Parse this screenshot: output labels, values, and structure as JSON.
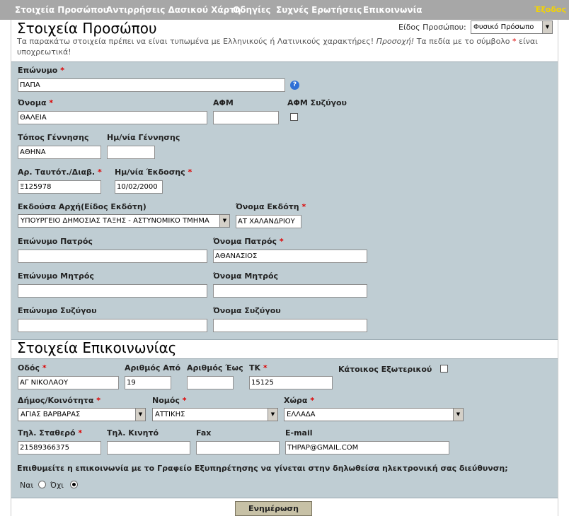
{
  "nav": {
    "items": [
      "Στοιχεία Προσώπου",
      "Αντιρρήσεις Δασικού Χάρτη",
      "Οδηγίες",
      "Συχνές Ερωτήσεις",
      "Επικοινωνία"
    ],
    "exit": "Έξοδος"
  },
  "person": {
    "title": "Στοιχεία Προσώπου",
    "type_label": "Είδος Προσώπου:",
    "type_value": "Φυσικό Πρόσωπο",
    "note_start": "Τα παρακάτω στοιχεία πρέπει να είναι τυπωμένα με Ελληνικούς ή Λατινικούς χαρακτήρες!",
    "note_em": "Προσοχή!",
    "note_mid": "Τα πεδία με το σύμβολο",
    "note_star": "*",
    "note_end": "είναι υποχρεωτικά!",
    "labels": {
      "surname": "Επώνυμο",
      "name": "Όνομα",
      "afm": "ΑΦΜ",
      "afm_spouse": "ΑΦΜ Συζύγου",
      "birthplace": "Τόπος Γέννησης",
      "birthdate": "Ημ/νία Γέννησης",
      "id_number": "Αρ. Ταυτότ./Διαβ.",
      "issue_date": "Ημ/νία Έκδοσης",
      "issuer_type": "Εκδούσα Αρχή(Είδος Εκδότη)",
      "issuer_name": "Όνομα Εκδότη",
      "father_surname": "Επώνυμο Πατρός",
      "father_name": "Όνομα Πατρός",
      "mother_surname": "Επώνυμο Μητρός",
      "mother_name": "Όνομα Μητρός",
      "spouse_surname": "Επώνυμο Συζύγου",
      "spouse_name": "Όνομα Συζύγου"
    },
    "values": {
      "surname": "ΠΑΠΑ",
      "name": "ΘΑΛΕΙΑ",
      "afm": "",
      "birthplace": "ΑΘΗΝΑ",
      "birthdate": "",
      "id_number": "Ξ125978",
      "issue_date": "10/02/2000",
      "issuer_type": "ΥΠΟΥΡΓΕΙΟ ΔΗΜΟΣΙΑΣ ΤΑΞΗΣ - ΑΣΤΥΝΟΜΙΚΟ ΤΜΗΜΑ",
      "issuer_name": "ΑΤ ΧΑΛΑΝΔΡΙΟΥ",
      "father_surname": "",
      "father_name": "ΑΘΑΝΑΣΙΟΣ",
      "mother_surname": "",
      "mother_name": "",
      "spouse_surname": "",
      "spouse_name": ""
    },
    "required_mark": "*",
    "help_glyph": "?"
  },
  "contact": {
    "title": "Στοιχεία Επικοινωνίας",
    "labels": {
      "street": "Οδός",
      "number_from": "Αριθμός Από",
      "number_to": "Αριθμός Έως",
      "zip": "ΤΚ",
      "abroad": "Κάτοικος Εξωτερικού",
      "municipality": "Δήμος/Κοινότητα",
      "prefecture": "Νομός",
      "country": "Χώρα",
      "phone": "Τηλ. Σταθερό",
      "mobile": "Τηλ. Κινητό",
      "fax": "Fax",
      "email": "E-mail"
    },
    "values": {
      "street": "ΑΓ ΝΙΚΟΛΑΟΥ",
      "number_from": "19",
      "number_to": "",
      "zip": "15125",
      "municipality": "ΑΓΙΑΣ ΒΑΡΒΑΡΑΣ",
      "prefecture": "ΑΤΤΙΚΗΣ",
      "country": "ΕΛΛΑΔΑ",
      "phone": "21589366375",
      "mobile": "",
      "fax": "",
      "email": "THPAP@GMAIL.COM"
    },
    "question": "Επιθυμείτε η επικοινωνία με το Γραφείο Εξυπηρέτησης να γίνεται στην δηλωθείσα ηλεκτρονική σας διεύθυνση;",
    "yes": "Ναι",
    "no": "Όχι",
    "selected": "Όχι"
  },
  "submit_label": "Ενημέρωση"
}
